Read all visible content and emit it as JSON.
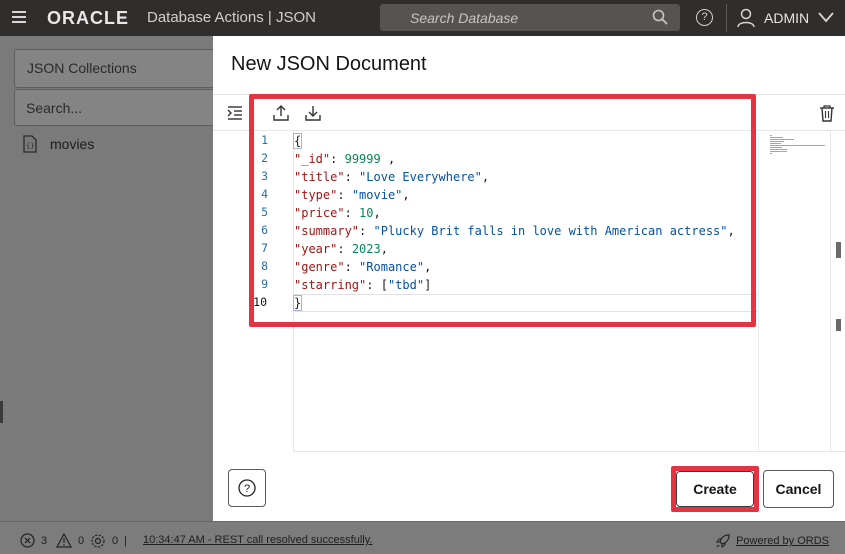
{
  "topbar": {
    "brand": "ORACLE",
    "product": "Database Actions |  JSON",
    "search_placeholder": "Search Database",
    "user": "ADMIN"
  },
  "left_panel": {
    "collection_select": "JSON Collections",
    "search_placeholder": "Search...",
    "items": [
      {
        "label": "movies"
      }
    ]
  },
  "dialog": {
    "title": "New JSON Document",
    "line_numbers": [
      "1",
      "2",
      "3",
      "4",
      "5",
      "6",
      "7",
      "8",
      "9",
      "10"
    ],
    "code_lines": [
      "{",
      "\"_id\": 99999 ,",
      "\"title\": \"Love Everywhere\",",
      "\"type\": \"movie\",",
      "\"price\": 10,",
      "\"summary\": \"Plucky Brit falls in love with American actress\",",
      "\"year\": 2023,",
      "\"genre\": \"Romance\",",
      "\"starring\": [\"tbd\"]",
      "}"
    ],
    "help_label": "?",
    "create_label": "Create",
    "cancel_label": "Cancel"
  },
  "statusbar": {
    "errors_count": "3",
    "warnings_count": "0",
    "settings_count": "0",
    "separator": "|",
    "message": "10:34:47 AM - REST call resolved successfully.",
    "powered": "Powered by ORDS"
  },
  "colors": {
    "highlight": "#e53341",
    "topbar": "#312d2a",
    "json_key": "#a31515",
    "json_string": "#0451a5",
    "json_number": "#098658"
  }
}
